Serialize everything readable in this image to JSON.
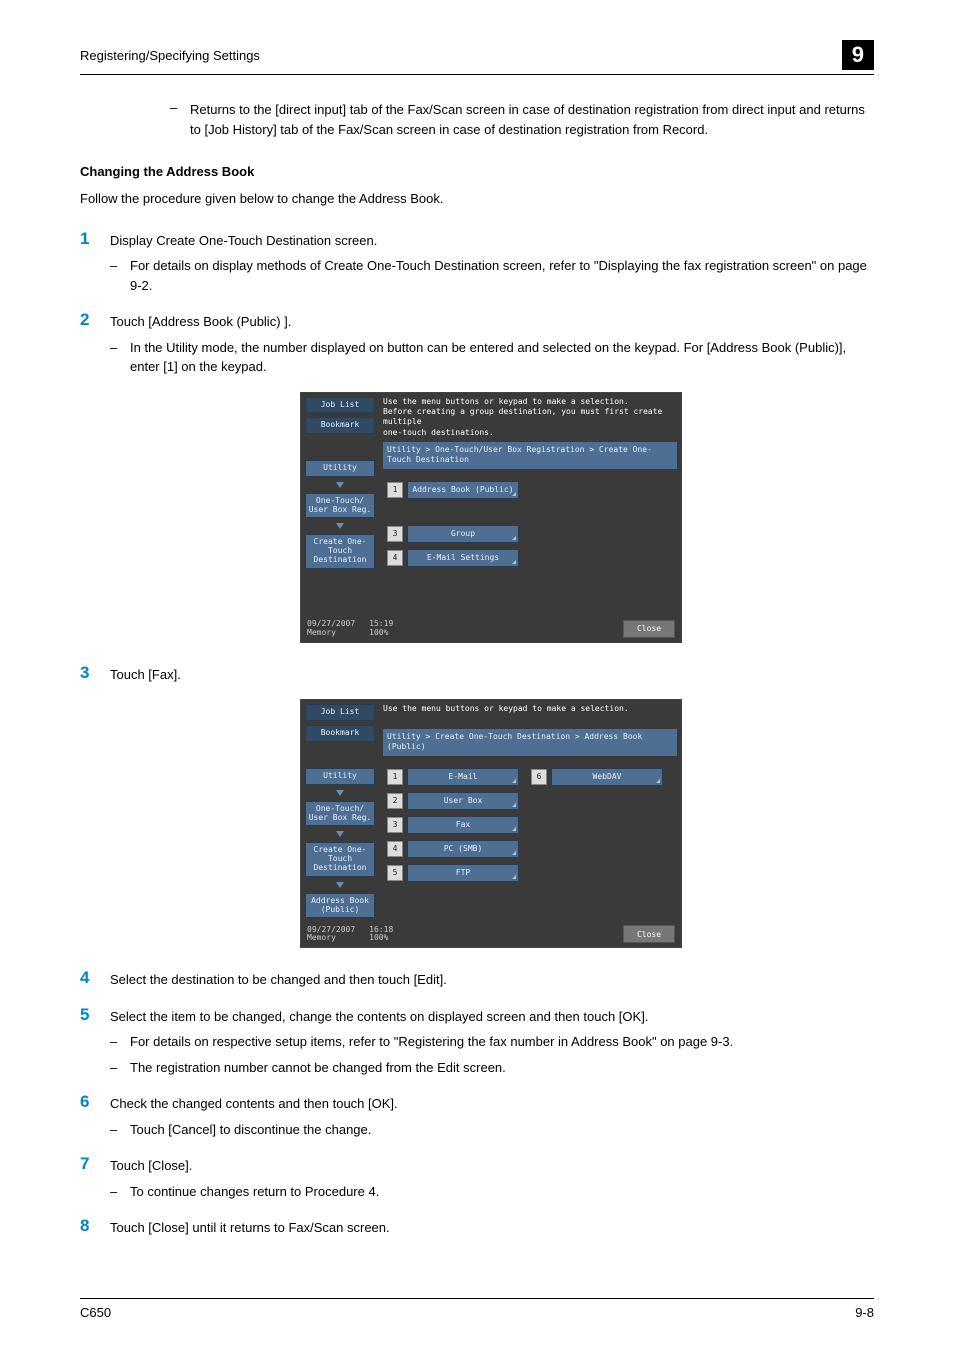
{
  "header": {
    "title": "Registering/Specifying Settings",
    "chapter": "9"
  },
  "intro_bullet": "Returns to the [direct input] tab of the Fax/Scan screen in case of destination registration from direct input and returns to [Job History] tab of the Fax/Scan screen in case of destination registration from Record.",
  "section": {
    "heading": "Changing the Address Book",
    "intro": "Follow the procedure given below to change the Address Book."
  },
  "steps": {
    "s1": {
      "num": "1",
      "text": "Display Create One-Touch Destination screen.",
      "bullet": "For details on display methods of Create One-Touch Destination screen, refer to \"Displaying the fax registration screen\" on page 9-2."
    },
    "s2": {
      "num": "2",
      "text": "Touch [Address Book (Public) ].",
      "bullet": "In the Utility mode, the number displayed on button can be entered and selected on the keypad. For [Address Book (Public)], enter [1] on the keypad."
    },
    "s3": {
      "num": "3",
      "text": "Touch [Fax]."
    },
    "s4": {
      "num": "4",
      "text": "Select the destination to be changed and then touch [Edit]."
    },
    "s5": {
      "num": "5",
      "text": "Select the item to be changed, change the contents on displayed screen and then touch [OK].",
      "b1": "For details on respective setup items, refer to \"Registering the fax number in Address Book\" on page 9-3.",
      "b2": "The registration number cannot be changed from the Edit screen."
    },
    "s6": {
      "num": "6",
      "text": "Check the changed contents and then touch [OK].",
      "bullet": "Touch [Cancel] to discontinue the change."
    },
    "s7": {
      "num": "7",
      "text": "Touch [Close].",
      "bullet": "To continue changes return to Procedure 4."
    },
    "s8": {
      "num": "8",
      "text": "Touch [Close] until it returns to Fax/Scan screen."
    }
  },
  "screen1": {
    "side": {
      "joblist": "Job List",
      "bookmark": "Bookmark",
      "utility": "Utility",
      "onetouch": "One-Touch/\nUser Box Reg.",
      "create": "Create One-Touch\nDestination"
    },
    "hint": "Use the menu buttons or keypad to make a selection.\nBefore creating a group destination, you must first create multiple\none-touch destinations.",
    "crumb": "Utility > One-Touch/User Box Registration > Create One-Touch Destination",
    "items": {
      "i1": {
        "n": "1",
        "label": "Address Book (Public)"
      },
      "i3": {
        "n": "3",
        "label": "Group"
      },
      "i4": {
        "n": "4",
        "label": "E-Mail Settings"
      }
    },
    "footer": {
      "date": "09/27/2007",
      "time": "15:19",
      "memlabel": "Memory",
      "mem": "100%",
      "close": "Close"
    }
  },
  "screen2": {
    "side": {
      "joblist": "Job List",
      "bookmark": "Bookmark",
      "utility": "Utility",
      "onetouch": "One-Touch/\nUser Box Reg.",
      "create": "Create One-Touch\nDestination",
      "addrbook": "Address Book\n(Public)"
    },
    "hint": "Use the menu buttons or keypad to make a selection.",
    "crumb": "Utility > Create One-Touch Destination > Address Book (Public)",
    "items": {
      "i1": {
        "n": "1",
        "label": "E-Mail"
      },
      "i2": {
        "n": "2",
        "label": "User Box"
      },
      "i3": {
        "n": "3",
        "label": "Fax"
      },
      "i4": {
        "n": "4",
        "label": "PC (SMB)"
      },
      "i5": {
        "n": "5",
        "label": "FTP"
      },
      "i6": {
        "n": "6",
        "label": "WebDAV"
      }
    },
    "footer": {
      "date": "09/27/2007",
      "time": "16:18",
      "memlabel": "Memory",
      "mem": "100%",
      "close": "Close"
    }
  },
  "footer": {
    "left": "C650",
    "right": "9-8"
  }
}
